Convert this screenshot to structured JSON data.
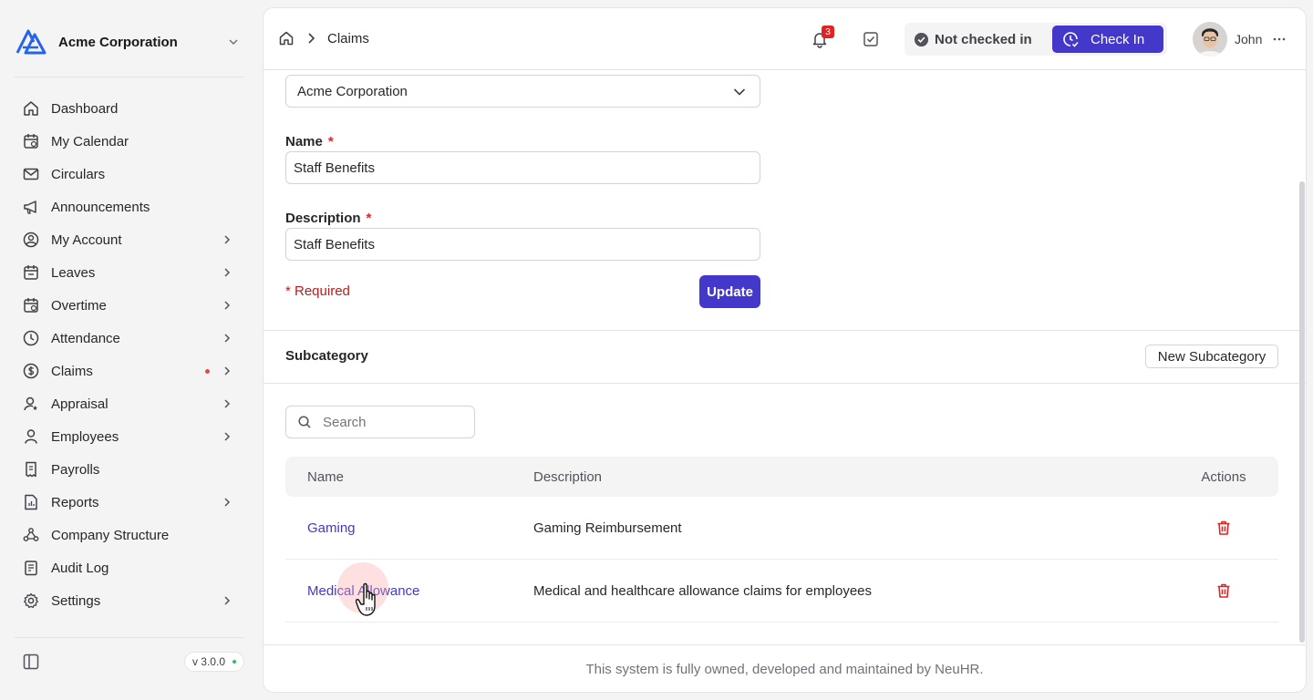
{
  "brand": {
    "name": "Acme Corporation",
    "icon": "acme-logo"
  },
  "sidebar": {
    "items": [
      {
        "label": "Dashboard",
        "icon": "home-icon",
        "has_arrow": false
      },
      {
        "label": "My Calendar",
        "icon": "calendar-icon",
        "has_arrow": false
      },
      {
        "label": "Circulars",
        "icon": "mail-icon",
        "has_arrow": false
      },
      {
        "label": "Announcements",
        "icon": "megaphone-icon",
        "has_arrow": false
      },
      {
        "label": "My Account",
        "icon": "user-circle-icon",
        "has_arrow": true
      },
      {
        "label": "Leaves",
        "icon": "calendar-check-icon",
        "has_arrow": true
      },
      {
        "label": "Overtime",
        "icon": "calendar-clock-icon",
        "has_arrow": true
      },
      {
        "label": "Attendance",
        "icon": "clock-icon",
        "has_arrow": true
      },
      {
        "label": "Claims",
        "icon": "dollar-icon",
        "has_arrow": true,
        "dot": true
      },
      {
        "label": "Appraisal",
        "icon": "user-star-icon",
        "has_arrow": true
      },
      {
        "label": "Employees",
        "icon": "user-icon",
        "has_arrow": true
      },
      {
        "label": "Payrolls",
        "icon": "receipt-icon",
        "has_arrow": false
      },
      {
        "label": "Reports",
        "icon": "file-chart-icon",
        "has_arrow": true
      },
      {
        "label": "Company Structure",
        "icon": "network-icon",
        "has_arrow": false
      },
      {
        "label": "Audit Log",
        "icon": "clipboard-icon",
        "has_arrow": false
      },
      {
        "label": "Settings",
        "icon": "gear-icon",
        "has_arrow": true
      }
    ],
    "version": "v 3.0.0"
  },
  "header": {
    "breadcrumb_current": "Claims",
    "notification_count": "3",
    "checkin_status": "Not checked in",
    "checkin_button": "Check In",
    "user_name": "John"
  },
  "form": {
    "company_value": "Acme Corporation",
    "name_label": "Name",
    "name_value": "Staff Benefits",
    "description_label": "Description",
    "description_value": "Staff Benefits",
    "required_asterisk": "*",
    "required_note": "* Required",
    "update_button": "Update"
  },
  "subcategory": {
    "title": "Subcategory",
    "new_button": "New Subcategory",
    "search_placeholder": "Search",
    "columns": {
      "name": "Name",
      "description": "Description",
      "actions": "Actions"
    },
    "rows": [
      {
        "name": "Gaming",
        "description": "Gaming Reimbursement"
      },
      {
        "name": "Medical Allowance",
        "description": "Medical and healthcare allowance claims for employees"
      }
    ]
  },
  "footer": {
    "note": "This system is fully owned, developed and maintained by NeuHR."
  },
  "colors": {
    "accent": "#4338ca",
    "danger": "#dc2626",
    "link": "#4338ca"
  }
}
